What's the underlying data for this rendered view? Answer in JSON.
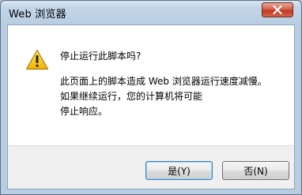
{
  "window": {
    "title": "Web 浏览器",
    "close_icon": "close-x-icon"
  },
  "dialog": {
    "icon": "warning-triangle-icon",
    "heading": "停止运行此脚本吗?",
    "message_lines": [
      "此页面上的脚本造成 Web 浏览器运行速度减慢。",
      "如果继续运行，您的计算机将可能",
      "停止响应。"
    ]
  },
  "buttons": {
    "yes_label": "是(Y)",
    "no_label": "否(N)"
  },
  "colors": {
    "titlebar": "#c3d6e8",
    "close_button": "#c2371f",
    "warning_yellow": "#f7c21b",
    "content_bg": "#ffffff",
    "footer_bg": "#f0f0f0"
  }
}
